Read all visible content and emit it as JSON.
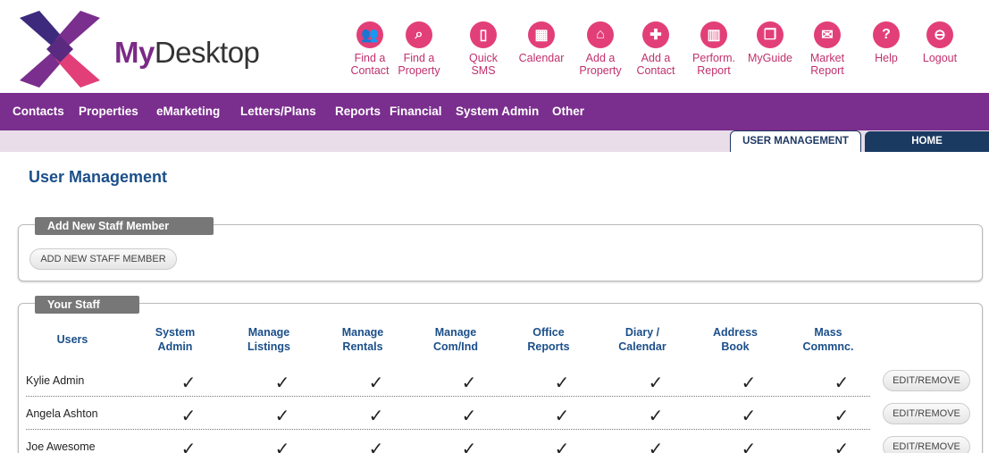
{
  "brand": {
    "prefix": "My",
    "suffix": "Desktop"
  },
  "toolbar": [
    {
      "label": "Find a\nContact",
      "icon": "contact-search-icon",
      "glyph": "👥"
    },
    {
      "label": "Find a\nProperty",
      "icon": "search-icon",
      "glyph": "⌕"
    },
    {
      "label": "Quick\nSMS",
      "icon": "phone-icon",
      "glyph": "▯"
    },
    {
      "label": "Calendar",
      "icon": "calendar-icon",
      "glyph": "▦"
    },
    {
      "label": "Add a\nProperty",
      "icon": "add-property-icon",
      "glyph": "⌂"
    },
    {
      "label": "Add a\nContact",
      "icon": "add-contact-icon",
      "glyph": "✚"
    },
    {
      "label": "Perform.\nReport",
      "icon": "chart-icon",
      "glyph": "▥"
    },
    {
      "label": "MyGuide",
      "icon": "guide-icon",
      "glyph": "❐"
    },
    {
      "label": "Market\nReport",
      "icon": "mail-icon",
      "glyph": "✉"
    },
    {
      "label": "Help",
      "icon": "help-icon",
      "glyph": "?"
    },
    {
      "label": "Logout",
      "icon": "logout-icon",
      "glyph": "⊖"
    }
  ],
  "nav": [
    "Contacts",
    "Properties",
    "eMarketing",
    "Letters/Plans",
    "Reports",
    "Financial",
    "System Admin",
    "Other"
  ],
  "tabs": {
    "user_management": "USER MANAGEMENT",
    "home": "HOME"
  },
  "page_title": "User Management",
  "add_panel": {
    "legend": "Add New Staff Member",
    "button": "ADD NEW STAFF MEMBER"
  },
  "staff_panel": {
    "legend": "Your Staff",
    "users_header": "Users",
    "columns": [
      "System\nAdmin",
      "Manage\nListings",
      "Manage\nRentals",
      "Manage\nCom/Ind",
      "Office\nReports",
      "Diary /\nCalendar",
      "Address\nBook",
      "Mass\nCommnc."
    ],
    "edit_label": "EDIT/REMOVE",
    "rows": [
      {
        "name": "Kylie Admin",
        "perms": [
          "✓",
          "✓",
          "✓",
          "✓",
          "✓",
          "✓",
          "✓",
          "✓"
        ]
      },
      {
        "name": "Angela Ashton",
        "perms": [
          "✓",
          "✓",
          "✓",
          "✓",
          "✓",
          "✓",
          "✓",
          "✓"
        ]
      },
      {
        "name": "Joe Awesome",
        "perms": [
          "✓",
          "✓",
          "✓",
          "✓",
          "✓",
          "✓",
          "✓",
          "✓"
        ]
      }
    ]
  },
  "colors": {
    "accent": "#e23f78",
    "nav": "#7a2e8d",
    "heading": "#1b4f8a",
    "home_tab": "#1b3a62"
  }
}
